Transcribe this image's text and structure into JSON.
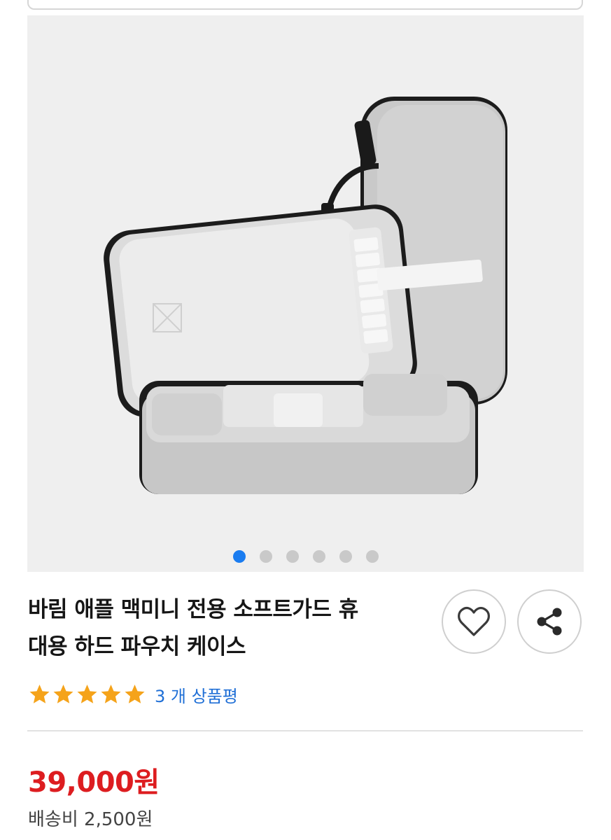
{
  "product": {
    "image_alt": "바림 애플 맥미니 전용 소프트가드 휴대용 하드 파우치 케이스",
    "carousel": {
      "count": 6,
      "active_index": 0
    },
    "title_line1": "바림 애플 맥미니 전용 소프트가드 휴",
    "title_line2": "대용 하드 파우치 케이스",
    "rating": {
      "stars": 5,
      "review_label": "3 개 상품평"
    },
    "price": "39,000원",
    "shipping": "배송비 2,500원"
  },
  "colors": {
    "accent": "#1a7cf0",
    "price": "#dd1d20",
    "star": "#f5a31a",
    "review_link": "#1f6fd6"
  },
  "icons": {
    "wishlist": "heart-icon",
    "share": "share-icon",
    "rating": "star-icon"
  }
}
